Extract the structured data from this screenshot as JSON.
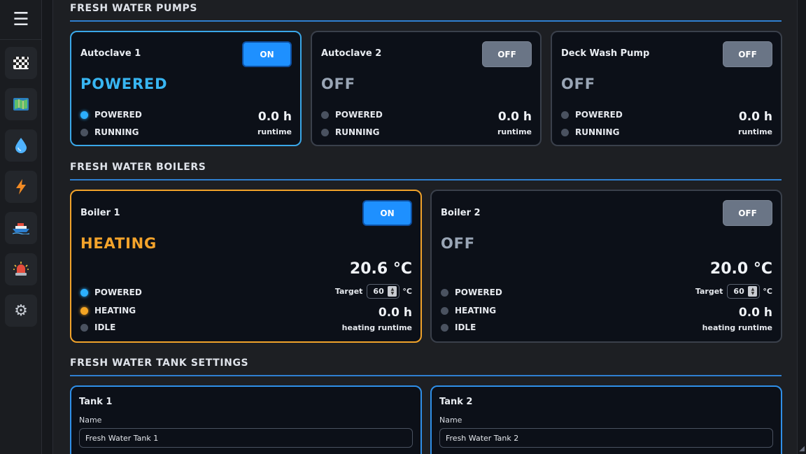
{
  "sidebar": {
    "menu_icon": "hamburger-menu-icon",
    "items": [
      {
        "name": "checkered-flag-icon",
        "glyph": "🏁"
      },
      {
        "name": "map-icon",
        "glyph": "🗺️"
      },
      {
        "name": "water-drop-icon",
        "glyph": "💧"
      },
      {
        "name": "lightning-icon",
        "glyph": "⚡"
      },
      {
        "name": "ship-icon",
        "glyph": "🚢"
      },
      {
        "name": "alarm-light-icon",
        "glyph": "🚨"
      },
      {
        "name": "gear-icon",
        "glyph": "⚙️"
      }
    ]
  },
  "pumps": {
    "title": "FRESH WATER PUMPS",
    "cards": [
      {
        "name": "Autoclave 1",
        "toggle": "ON",
        "state": "POWERED",
        "powered": "POWERED",
        "running": "RUNNING",
        "runtime": "0.0 h",
        "runtime_label": "runtime"
      },
      {
        "name": "Autoclave 2",
        "toggle": "OFF",
        "state": "OFF",
        "powered": "POWERED",
        "running": "RUNNING",
        "runtime": "0.0 h",
        "runtime_label": "runtime"
      },
      {
        "name": "Deck Wash Pump",
        "toggle": "OFF",
        "state": "OFF",
        "powered": "POWERED",
        "running": "RUNNING",
        "runtime": "0.0 h",
        "runtime_label": "runtime"
      }
    ]
  },
  "boilers": {
    "title": "FRESH WATER BOILERS",
    "cards": [
      {
        "name": "Boiler 1",
        "toggle": "ON",
        "state": "HEATING",
        "temp": "20.6 °C",
        "target_label": "Target",
        "target_value": "60",
        "target_unit": "°C",
        "powered": "POWERED",
        "heating": "HEATING",
        "idle": "IDLE",
        "runtime": "0.0 h",
        "runtime_label": "heating runtime"
      },
      {
        "name": "Boiler 2",
        "toggle": "OFF",
        "state": "OFF",
        "temp": "20.0 °C",
        "target_label": "Target",
        "target_value": "60",
        "target_unit": "°C",
        "powered": "POWERED",
        "heating": "HEATING",
        "idle": "IDLE",
        "runtime": "0.0 h",
        "runtime_label": "heating runtime"
      }
    ]
  },
  "tanks": {
    "title": "FRESH WATER TANK SETTINGS",
    "cards": [
      {
        "title": "Tank 1",
        "name_label": "Name",
        "name_value": "Fresh Water Tank 1"
      },
      {
        "title": "Tank 2",
        "name_label": "Name",
        "name_value": "Fresh Water Tank 2"
      }
    ]
  },
  "colors": {
    "accent_blue": "#1e90ff",
    "powered_blue": "#38b6f2",
    "heating_orange": "#f3a32b",
    "inactive_gray": "#6a7586"
  }
}
